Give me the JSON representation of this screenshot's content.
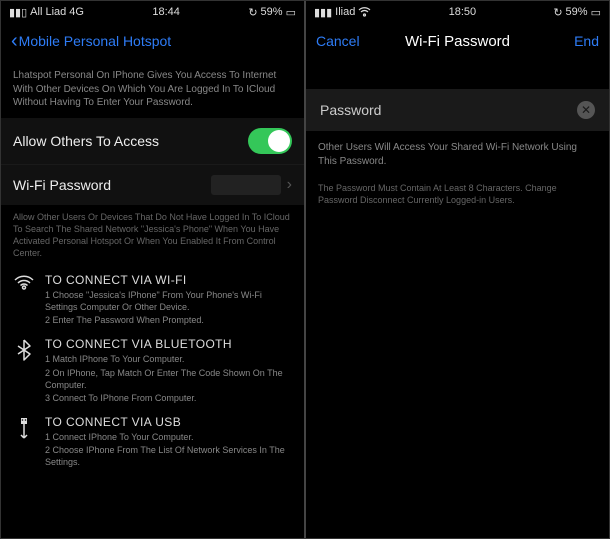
{
  "left": {
    "status": {
      "carrier": "All Liad 4G",
      "time": "18:44",
      "battery": "59%"
    },
    "nav": {
      "back": "Mobile Personal Hotspot"
    },
    "intro": "Lhatspot Personal On IPhone Gives You Access To Internet With Other Devices On Which You Are Logged In To ICloud Without Having To Enter Your Password.",
    "allowRow": {
      "label": "Allow Others To Access"
    },
    "pwRow": {
      "label": "Wi-Fi Password"
    },
    "note": "Allow Other Users Or Devices That Do Not Have Logged In To ICloud To Search The Shared Network \"Jessica's Phone\" When You Have Activated Personal Hotspot Or When You Enabled It From Control Center.",
    "wifi": {
      "title": "TO CONNECT VIA WI-FI",
      "s1": "1 Choose \"Jessica's IPhone\" From Your Phone's Wi-Fi Settings Computer Or Other Device.",
      "s2": "2 Enter The Password When Prompted."
    },
    "bt": {
      "title": "TO CONNECT VIA BLUETOOTH",
      "s1": "1 Match IPhone To Your Computer.",
      "s2": "2 On IPhone, Tap Match Or Enter The Code Shown On The Computer.",
      "s3": "3 Connect To IPhone From Computer."
    },
    "usb": {
      "title": "TO CONNECT VIA USB",
      "s1": "1 Connect IPhone To Your Computer.",
      "s2": "2 Choose IPhone From The List Of Network Services In The Settings."
    }
  },
  "right": {
    "status": {
      "carrier": "Iliad",
      "time": "18:50",
      "battery": "59%"
    },
    "nav": {
      "cancel": "Cancel",
      "title": "Wi-Fi Password",
      "end": "End"
    },
    "pwLabel": "Password",
    "desc": "Other Users Will Access Your Shared Wi-Fi Network Using This Password.",
    "rule": "The Password Must Contain At Least 8 Characters. Change Password Disconnect Currently Logged-in Users."
  }
}
